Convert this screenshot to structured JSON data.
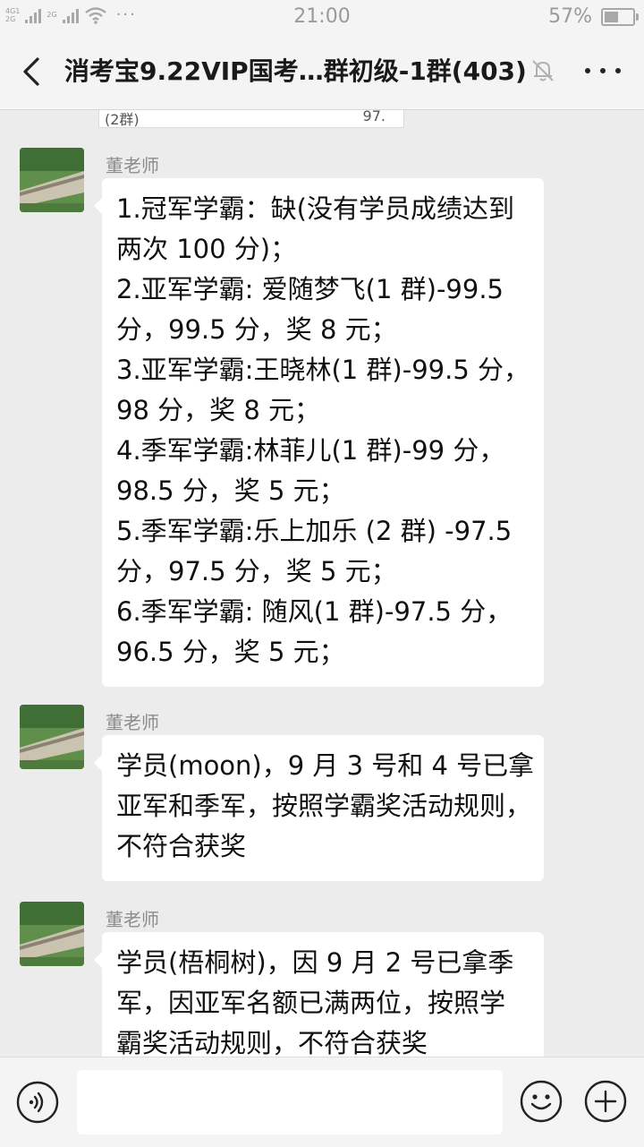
{
  "status_bar": {
    "network_top": "4G1",
    "network_bottom": "2G",
    "network_2g": "2G",
    "dots": "···",
    "time": "21:00",
    "battery_percent": "57%",
    "battery_level": 0.57
  },
  "header": {
    "title": "消考宝9.22VIP国考…群初级-1群(403)"
  },
  "previous_card": {
    "left_text": "(2群)",
    "right_text": "97."
  },
  "messages": [
    {
      "sender": "董老师",
      "lines": [
        "1.冠军学霸：缺(没有学员成绩达到",
        "两次 100 分)；",
        "2.亚军学霸: 爱随梦飞(1 群)-99.5",
        "分，99.5 分，奖 8 元；",
        "3.亚军学霸:王晓林(1 群)-99.5 分，",
        "98 分，奖 8 元；",
        "4.季军学霸:林菲儿(1 群)-99 分，",
        "98.5 分，奖 5 元；",
        "5.季军学霸:乐上加乐  (2 群) -97.5",
        "分，97.5 分，奖 5 元；",
        "6.季军学霸: 随风(1 群)-97.5 分，",
        "96.5 分，奖 5 元；"
      ]
    },
    {
      "sender": "董老师",
      "lines": [
        "学员(moon)，9 月 3 号和 4 号已拿",
        "亚军和季军，按照学霸奖活动规则，",
        "不符合获奖"
      ]
    },
    {
      "sender": "董老师",
      "lines": [
        "学员(梧桐树)，因 9 月 2 号已拿季",
        "军，因亚军名额已满两位，按照学",
        "霸奖活动规则，不符合获奖"
      ]
    }
  ],
  "input_bar": {
    "placeholder": ""
  },
  "icons": {
    "back": "back-arrow-icon",
    "mute": "bell-muted-icon",
    "more": "more-dots-icon",
    "voice": "voice-icon",
    "emoji": "emoji-icon",
    "plus": "plus-icon"
  }
}
